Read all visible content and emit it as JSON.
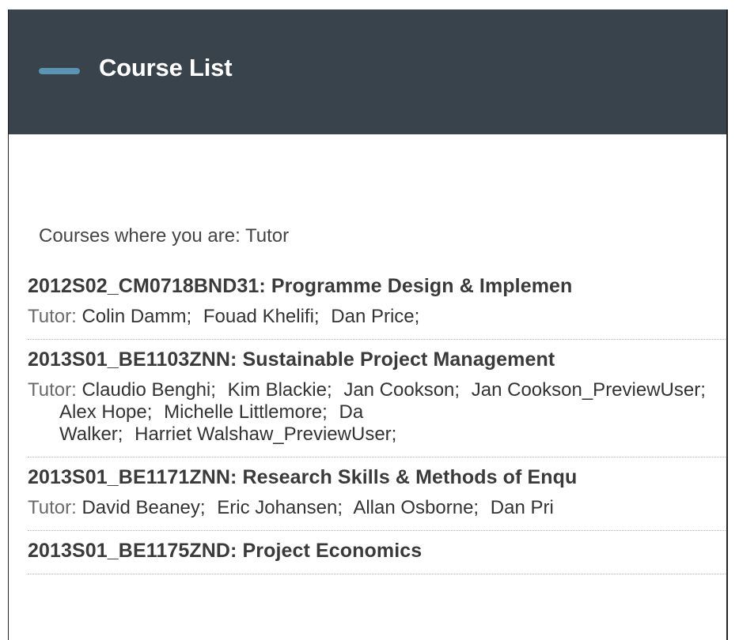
{
  "module": {
    "title": "Course List"
  },
  "role_heading": "Courses where you are: Tutor",
  "instructor_label": "Tutor:",
  "courses": [
    {
      "title": "2012S02_CM0718BND31: Programme Design & Implemen",
      "instructors": [
        "Colin Damm;",
        "Fouad Khelifi;",
        "Dan Price;"
      ]
    },
    {
      "title": "2013S01_BE1103ZNN: Sustainable Project Management",
      "instructors": [
        "Claudio Benghi;",
        "Kim Blackie;",
        "Jan Cookson;",
        "Jan Cookson_PreviewUser;",
        "Alex Hope;",
        "Michelle Littlemore;",
        "Da",
        "Walker;",
        "Harriet Walshaw_PreviewUser;"
      ]
    },
    {
      "title": "2013S01_BE1171ZNN: Research Skills & Methods of Enqu",
      "instructors": [
        "David Beaney;",
        "Eric Johansen;",
        "Allan Osborne;",
        "Dan Pri"
      ]
    },
    {
      "title": "2013S01_BE1175ZND: Project Economics",
      "instructors": []
    }
  ]
}
